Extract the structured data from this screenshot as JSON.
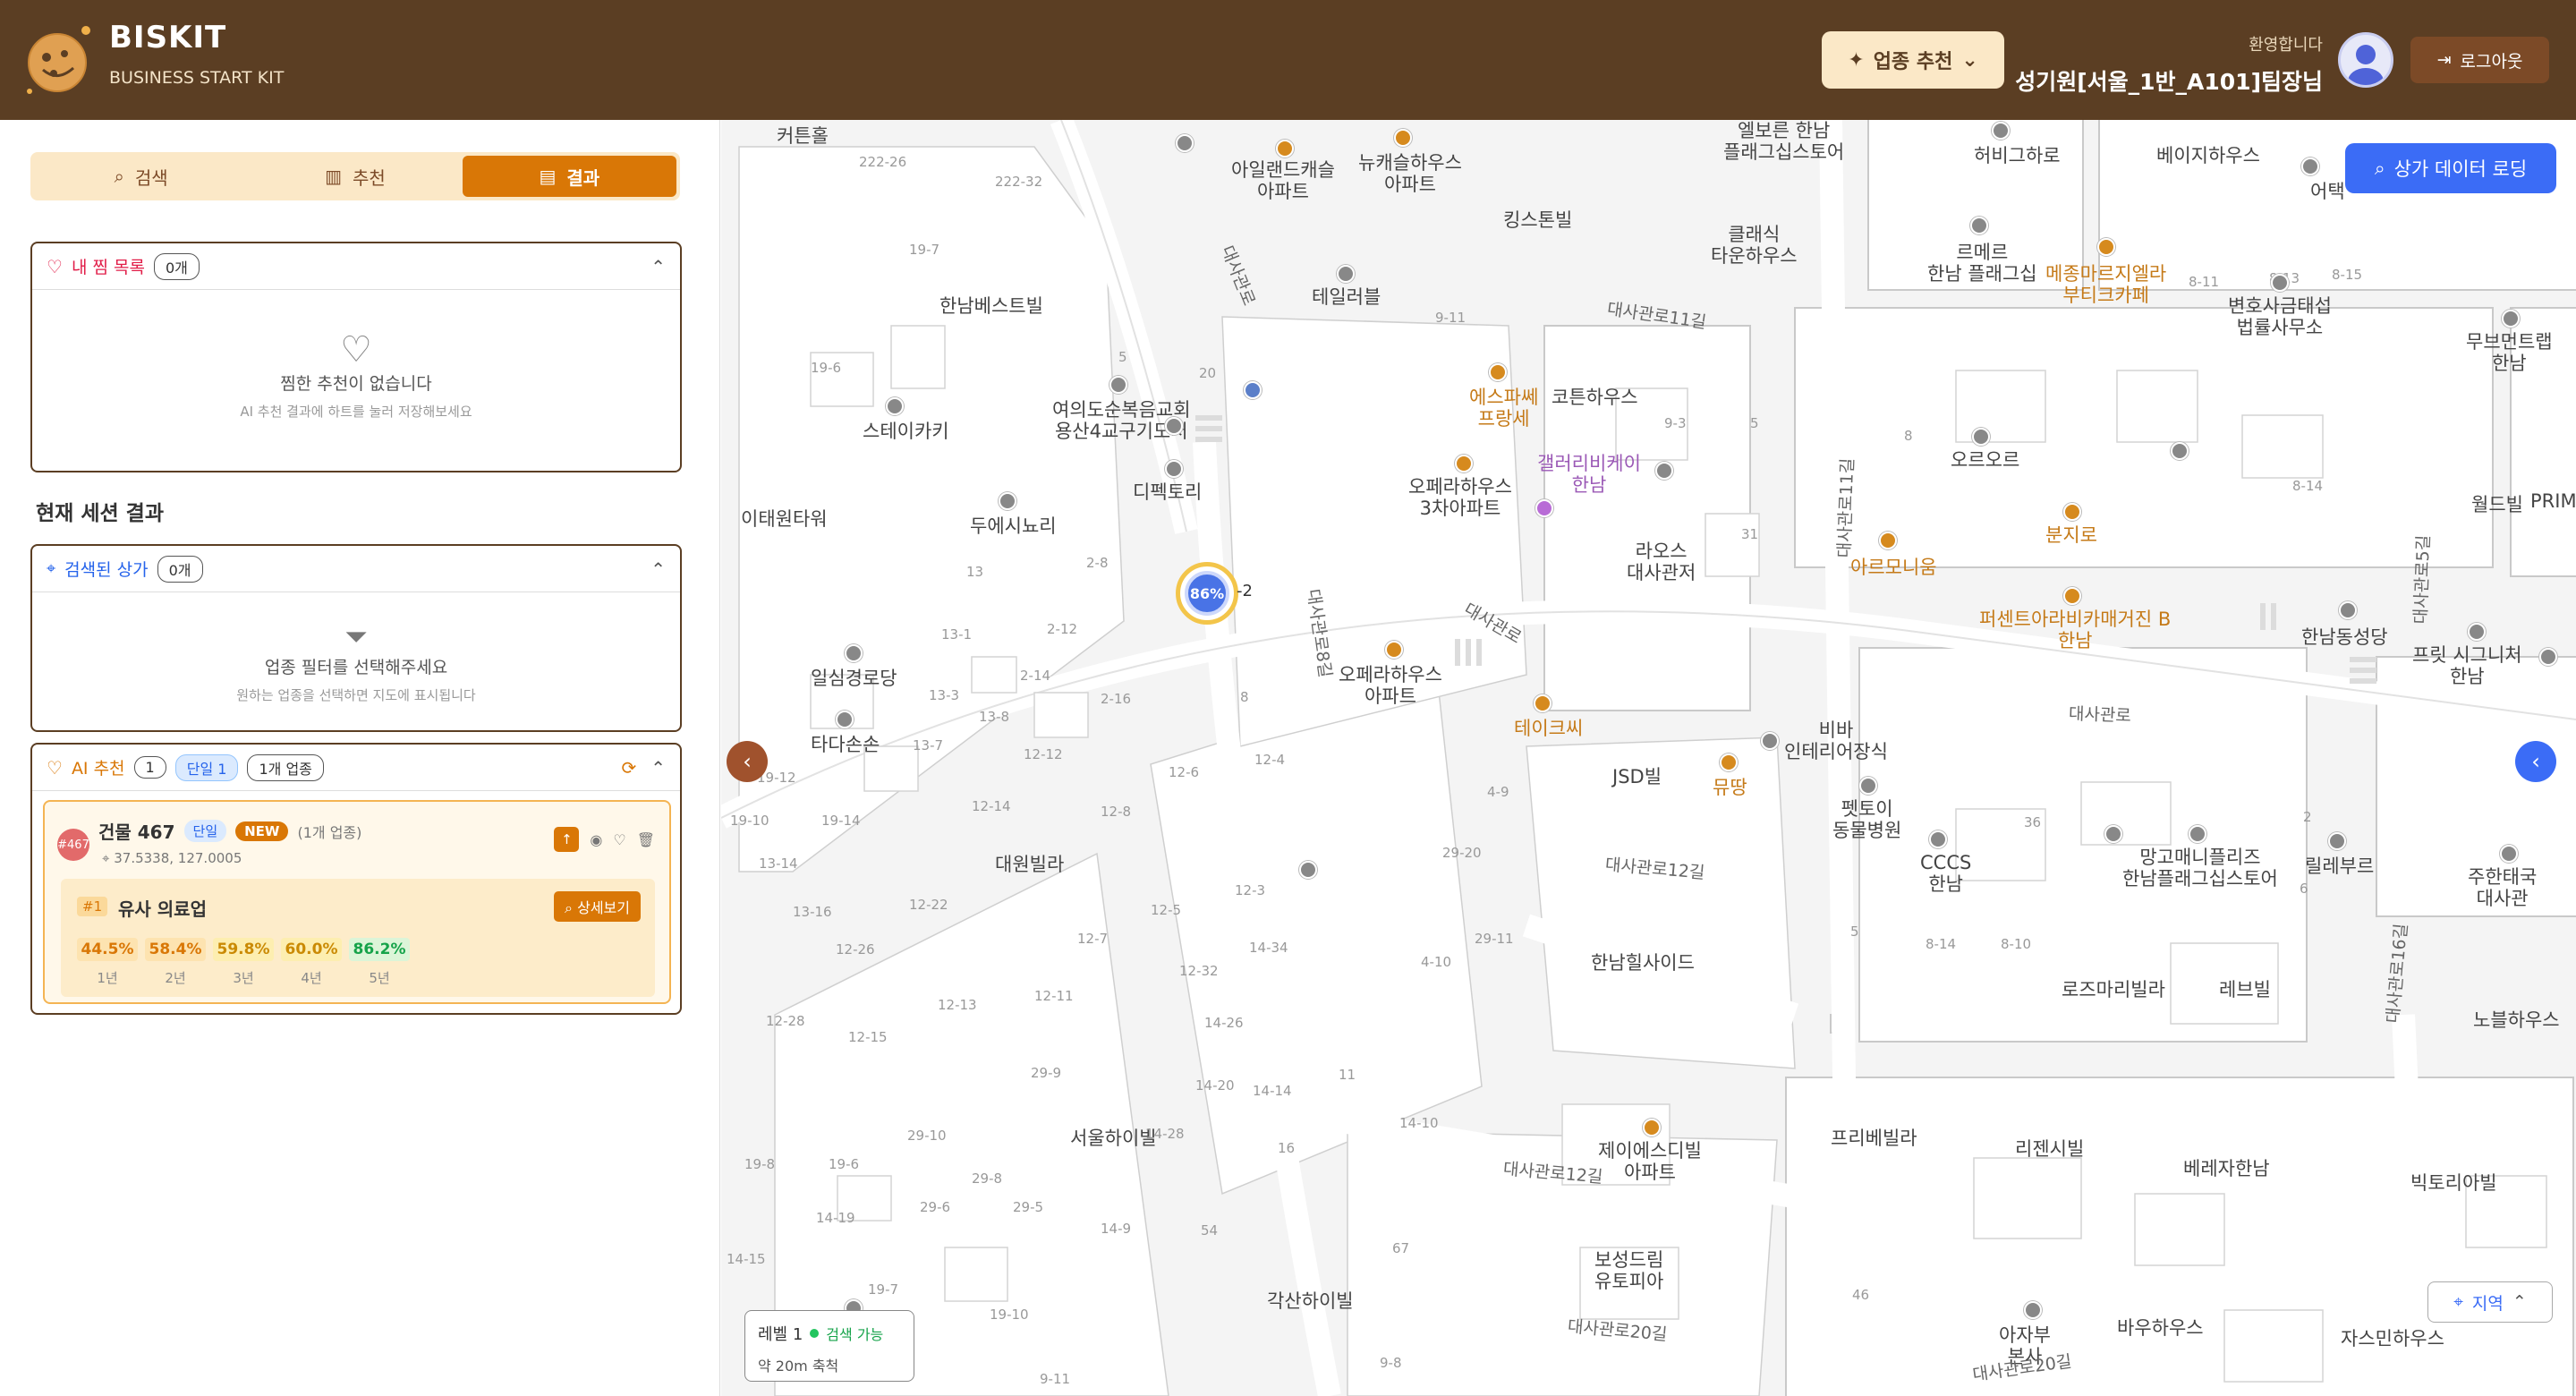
{
  "header": {
    "brand_name": "BISKIT",
    "brand_tagline": "BUSINESS START KIT",
    "recommend_button": "업종 추천",
    "welcome": "환영합니다",
    "user_name": "성기원[서울_1반_A101]팀장님",
    "logout": "로그아웃"
  },
  "tabs": [
    {
      "label": "검색",
      "icon": "search-icon"
    },
    {
      "label": "추천",
      "icon": "bar-chart-icon"
    },
    {
      "label": "결과",
      "icon": "document-icon",
      "active": true
    }
  ],
  "favorites": {
    "title": "내 찜 목록",
    "count": "0개",
    "empty_title": "찜한 추천이 없습니다",
    "empty_desc": "AI 추천 결과에 하트를 눌러 저장해보세요"
  },
  "session_title": "현재 세션 결과",
  "searched": {
    "title": "검색된 상가",
    "count": "0개",
    "empty_title": "업종 필터를 선택해주세요",
    "empty_desc": "원하는 업종을 선택하면 지도에 표시됩니다"
  },
  "ai": {
    "title": "AI 추천",
    "count": "1",
    "tag_single": "단일 1",
    "tag_industry": "1개 업종",
    "item": {
      "badge": "#467",
      "building": "건물 467",
      "tag_single": "단일",
      "tag_new": "NEW",
      "industry_count": "(1개 업종)",
      "coords": "37.5338, 127.0005",
      "rank": "#1",
      "industry": "유사 의료업",
      "detail_button": "상세보기",
      "rates": [
        {
          "value": "44.5%",
          "year": "1년",
          "color": "#d97706"
        },
        {
          "value": "58.4%",
          "year": "2년",
          "color": "#d97706"
        },
        {
          "value": "59.8%",
          "year": "3년",
          "color": "#ca8a04"
        },
        {
          "value": "60.0%",
          "year": "4년",
          "color": "#ca8a04"
        },
        {
          "value": "86.2%",
          "year": "5년",
          "color": "#16a34a"
        }
      ]
    }
  },
  "map": {
    "loading_button": "상가 데이터 로딩",
    "cluster_value": "86%",
    "cluster_side": "-2",
    "level": "레벨 1",
    "level_status": "검색 가능",
    "scale": "약 20m 축척",
    "region_button": "지역",
    "labels": [
      {
        "t": "커튼홀"
      },
      {
        "t": "아일랜드캐슬\n아파트"
      },
      {
        "t": "뉴캐슬하우스\n아파트"
      },
      {
        "t": "엘보른 한남\n플래그십스토어"
      },
      {
        "t": "허비그하로"
      },
      {
        "t": "베이지하우스"
      },
      {
        "t": "어택"
      },
      {
        "t": "킹스톤빌"
      },
      {
        "t": "클래식\n타운하우스"
      },
      {
        "t": "르메르\n한남 플래그십"
      },
      {
        "t": "메종마르지엘라\n부티크카페"
      },
      {
        "t": "변호사금태섭\n법률사무소"
      },
      {
        "t": "무브먼트랩\n한남"
      },
      {
        "t": "한남베스트빌"
      },
      {
        "t": "테일러블"
      },
      {
        "t": "여의도순복음교회\n용산4교구기도처"
      },
      {
        "t": "스테이카키"
      },
      {
        "t": "에스파쎄\n프랑세"
      },
      {
        "t": "코튼하우스"
      },
      {
        "t": "오르오르"
      },
      {
        "t": "디펙토리"
      },
      {
        "t": "갤러리비케이\n한남"
      },
      {
        "t": "오페라하우스\n3차아파트"
      },
      {
        "t": "이태원타워"
      },
      {
        "t": "두에시뇨리"
      },
      {
        "t": "라오스\n대사관저"
      },
      {
        "t": "아르모니움"
      },
      {
        "t": "분지로"
      },
      {
        "t": "월드빌"
      },
      {
        "t": "PRIM"
      },
      {
        "t": "퍼센트아라비카매거진 B\n한남"
      },
      {
        "t": "한남동성당"
      },
      {
        "t": "일심경로당"
      },
      {
        "t": "오페라하우스\n아파트"
      },
      {
        "t": "프릿 시그니처\n한남"
      },
      {
        "t": "타다손손"
      },
      {
        "t": "테이크씨"
      },
      {
        "t": "비바\n인테리어장식"
      },
      {
        "t": "JSD빌"
      },
      {
        "t": "뮤땅"
      },
      {
        "t": "펫토이\n동물병원"
      },
      {
        "t": "대원빌라"
      },
      {
        "t": "CCCS\n한남"
      },
      {
        "t": "망고매니플리즈\n한남플래그십스토어"
      },
      {
        "t": "릴레부르"
      },
      {
        "t": "주한태국\n대사관"
      },
      {
        "t": "한남힐사이드"
      },
      {
        "t": "로즈마리빌라"
      },
      {
        "t": "레브빌"
      },
      {
        "t": "노블하우스"
      },
      {
        "t": "서울하이빌"
      },
      {
        "t": "프리베빌라"
      },
      {
        "t": "리젠시빌"
      },
      {
        "t": "베레자한남"
      },
      {
        "t": "제이에스디빌\n아파트"
      },
      {
        "t": "빅토리아빌"
      },
      {
        "t": "보성드림\n유토피아"
      },
      {
        "t": "각산하이빌"
      },
      {
        "t": "아자부\n본사"
      },
      {
        "t": "바우하우스"
      },
      {
        "t": "자스민하우스"
      }
    ],
    "roads": [
      "대사관로",
      "대사관로11길",
      "대사관로11길",
      "대사관로8길",
      "대사관로",
      "대사관로",
      "대사관로12길",
      "대사관로12길",
      "대사관로20길",
      "대사관로20길",
      "대사관로16길",
      "대사관로5길"
    ],
    "numbers": [
      "222-26",
      "222-32",
      "19-7",
      "19-6",
      "13",
      "13-1",
      "13-3",
      "13-8",
      "13-7",
      "12-12",
      "12-14",
      "12-8",
      "12-6",
      "12-4",
      "2-8",
      "2-12",
      "2-14",
      "2-16",
      "8",
      "20",
      "5",
      "9-11",
      "9-3",
      "5",
      "8",
      "31",
      "8-14",
      "8-11",
      "8-13",
      "8-15",
      "36",
      "2",
      "6",
      "5",
      "8-14",
      "8-10",
      "19-12",
      "19-10",
      "19-14",
      "13-14",
      "13-16",
      "12-22",
      "12-26",
      "12-13",
      "12-15",
      "12-28",
      "12-11",
      "12-7",
      "12-5",
      "12-3",
      "12-32",
      "14-34",
      "14-28",
      "14-26",
      "14-20",
      "14-14",
      "14-10",
      "16",
      "11",
      "4-10",
      "4-9",
      "29-20",
      "29-11",
      "29-9",
      "29-10",
      "29-8",
      "29-5",
      "29-6",
      "19-7",
      "19-10",
      "19-8",
      "19-6",
      "14-19",
      "14-15",
      "14-9",
      "54",
      "67",
      "46",
      "9-8",
      "9-11"
    ]
  }
}
